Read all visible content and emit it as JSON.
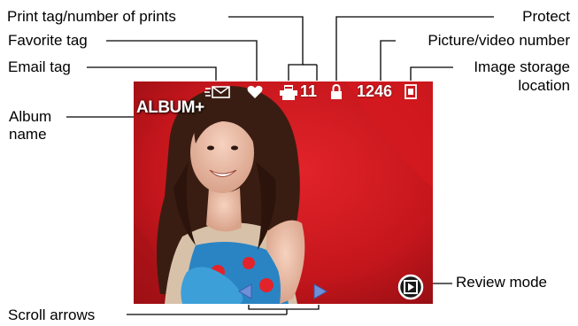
{
  "callouts": {
    "print_tag": "Print tag/number of prints",
    "favorite_tag": "Favorite tag",
    "email_tag": "Email tag",
    "album_name_line1": "Album",
    "album_name_line2": "name",
    "protect": "Protect",
    "picture_number": "Picture/video number",
    "storage_line1": "Image storage",
    "storage_line2": "location",
    "review_mode": "Review mode",
    "scroll_arrows": "Scroll arrows"
  },
  "overlay": {
    "album_tag": "ALBUM+",
    "print_count": "11",
    "picture_number": "1246"
  },
  "icons": [
    "email-icon",
    "heart-icon",
    "print-icon",
    "lock-icon",
    "memory-card-icon",
    "review-mode-icon",
    "scroll-left-arrow-icon",
    "scroll-right-arrow-icon"
  ],
  "colors": {
    "background_red": "#c4161c",
    "overlay_text": "#ffffff",
    "scroll_arrow": "#6f8fd8"
  }
}
